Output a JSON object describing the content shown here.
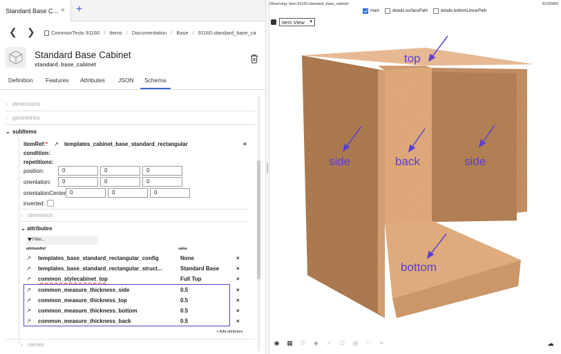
{
  "browser_tab": {
    "title": "Standard Base C...",
    "close": "×",
    "new": "+"
  },
  "breadcrumbs": [
    "CommonTests 91160",
    "Items",
    "Documentation",
    "Base",
    "91160.standard_base_ca"
  ],
  "item": {
    "title": "Standard Base Cabinet",
    "subtitle": "standard_base_cabinet"
  },
  "tabs": [
    "Definition",
    "Features",
    "Attributes",
    "JSON",
    "Schema"
  ],
  "active_tab": "Schema",
  "schema": {
    "sections": {
      "dimensions": "dimensions",
      "geometries": "geometries",
      "subitems": "subItems",
      "names": "names"
    },
    "itemref": {
      "label": "itemRef:",
      "required": "*",
      "value": "templates_cabinet_base_standard_rectangular",
      "remove": "×"
    },
    "condition_label": "condition:",
    "repetitions_label": "repetitions:",
    "position": {
      "label": "position:",
      "values": [
        "0",
        "0",
        "0"
      ]
    },
    "orientation": {
      "label": "orientation:",
      "values": [
        "0",
        "0",
        "0"
      ]
    },
    "orientation_center": {
      "label": "orientationCenter:",
      "values": [
        "0",
        "0",
        "0"
      ]
    },
    "inverted_label": "inverted:",
    "dimension_label": "dimension",
    "attributes_label": "attributes",
    "filter_label": "Filter...",
    "col_attribute": "attributeRef",
    "col_value": "value",
    "add_attributes": "+ Add attributes",
    "attributes": [
      {
        "name": "templates_base_standard_rectangular_config",
        "value": "None"
      },
      {
        "name": "templates_base_standard_rectangular_struct...",
        "value": "Standard Base"
      },
      {
        "name": "common_stylecabinet_top",
        "value": "Full Top"
      },
      {
        "name": "common_measure_thickness_side",
        "value": "0.5"
      },
      {
        "name": "common_measure_thickness_top",
        "value": "0.5"
      },
      {
        "name": "common_measure_thickness_bottom",
        "value": "0.5"
      },
      {
        "name": "common_measure_thickness_back",
        "value": "0.5"
      }
    ],
    "remove_symbol": "×"
  },
  "viewer": {
    "observing": "Observing: Item-91160.standard_base_cabinet",
    "size": "812|0960",
    "checkboxes": [
      {
        "label": "main",
        "checked": true
      },
      {
        "label": "details.surfacePath",
        "checked": false
      },
      {
        "label": "details.bottomLinearPath",
        "checked": false
      }
    ],
    "view_select": "Item View",
    "annotations": [
      "top",
      "side",
      "back",
      "side",
      "bottom"
    ],
    "annotation_color": "#5b3fd0",
    "wood_color": "#e0a878"
  }
}
